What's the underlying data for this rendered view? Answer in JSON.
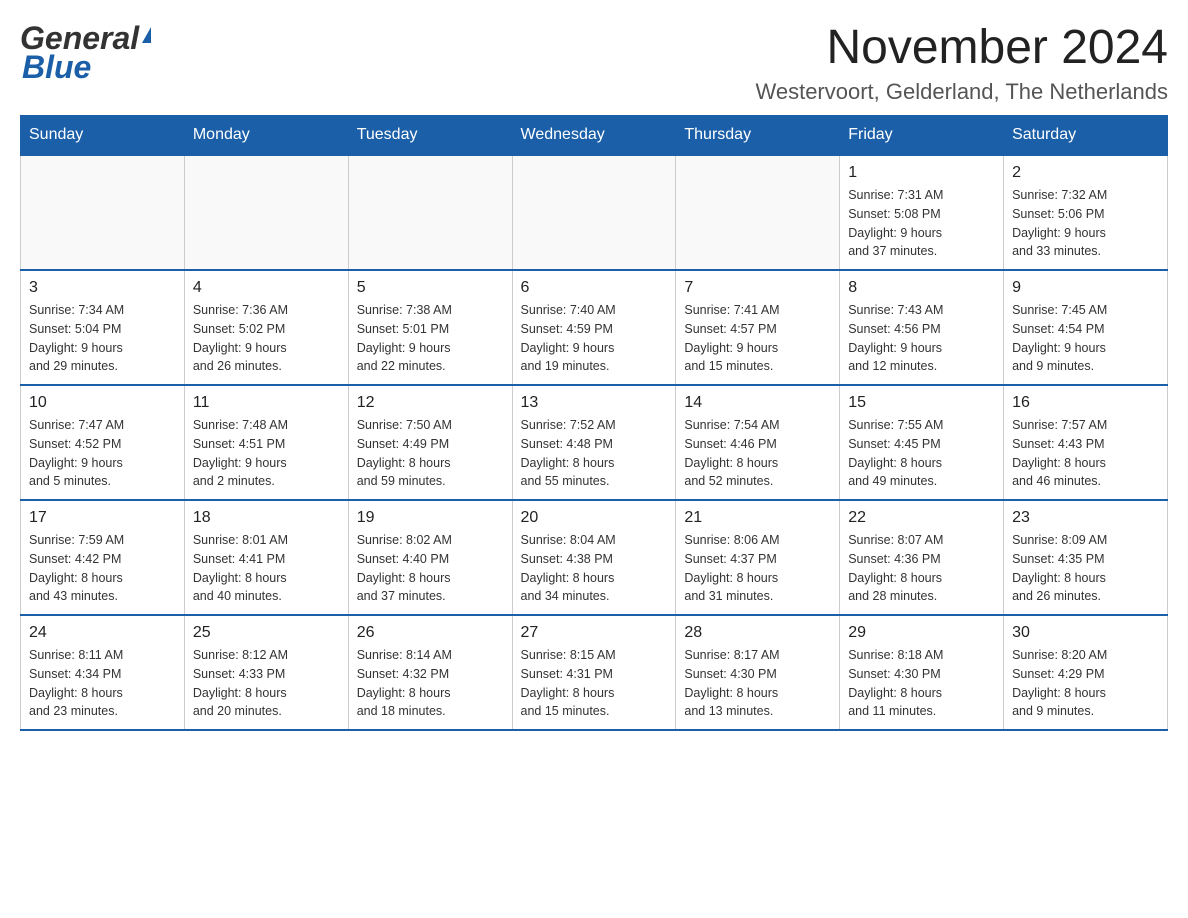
{
  "header": {
    "logo_general": "General",
    "logo_blue": "Blue",
    "month_title": "November 2024",
    "location": "Westervoort, Gelderland, The Netherlands"
  },
  "weekdays": [
    "Sunday",
    "Monday",
    "Tuesday",
    "Wednesday",
    "Thursday",
    "Friday",
    "Saturday"
  ],
  "weeks": [
    [
      {
        "day": "",
        "info": ""
      },
      {
        "day": "",
        "info": ""
      },
      {
        "day": "",
        "info": ""
      },
      {
        "day": "",
        "info": ""
      },
      {
        "day": "",
        "info": ""
      },
      {
        "day": "1",
        "info": "Sunrise: 7:31 AM\nSunset: 5:08 PM\nDaylight: 9 hours\nand 37 minutes."
      },
      {
        "day": "2",
        "info": "Sunrise: 7:32 AM\nSunset: 5:06 PM\nDaylight: 9 hours\nand 33 minutes."
      }
    ],
    [
      {
        "day": "3",
        "info": "Sunrise: 7:34 AM\nSunset: 5:04 PM\nDaylight: 9 hours\nand 29 minutes."
      },
      {
        "day": "4",
        "info": "Sunrise: 7:36 AM\nSunset: 5:02 PM\nDaylight: 9 hours\nand 26 minutes."
      },
      {
        "day": "5",
        "info": "Sunrise: 7:38 AM\nSunset: 5:01 PM\nDaylight: 9 hours\nand 22 minutes."
      },
      {
        "day": "6",
        "info": "Sunrise: 7:40 AM\nSunset: 4:59 PM\nDaylight: 9 hours\nand 19 minutes."
      },
      {
        "day": "7",
        "info": "Sunrise: 7:41 AM\nSunset: 4:57 PM\nDaylight: 9 hours\nand 15 minutes."
      },
      {
        "day": "8",
        "info": "Sunrise: 7:43 AM\nSunset: 4:56 PM\nDaylight: 9 hours\nand 12 minutes."
      },
      {
        "day": "9",
        "info": "Sunrise: 7:45 AM\nSunset: 4:54 PM\nDaylight: 9 hours\nand 9 minutes."
      }
    ],
    [
      {
        "day": "10",
        "info": "Sunrise: 7:47 AM\nSunset: 4:52 PM\nDaylight: 9 hours\nand 5 minutes."
      },
      {
        "day": "11",
        "info": "Sunrise: 7:48 AM\nSunset: 4:51 PM\nDaylight: 9 hours\nand 2 minutes."
      },
      {
        "day": "12",
        "info": "Sunrise: 7:50 AM\nSunset: 4:49 PM\nDaylight: 8 hours\nand 59 minutes."
      },
      {
        "day": "13",
        "info": "Sunrise: 7:52 AM\nSunset: 4:48 PM\nDaylight: 8 hours\nand 55 minutes."
      },
      {
        "day": "14",
        "info": "Sunrise: 7:54 AM\nSunset: 4:46 PM\nDaylight: 8 hours\nand 52 minutes."
      },
      {
        "day": "15",
        "info": "Sunrise: 7:55 AM\nSunset: 4:45 PM\nDaylight: 8 hours\nand 49 minutes."
      },
      {
        "day": "16",
        "info": "Sunrise: 7:57 AM\nSunset: 4:43 PM\nDaylight: 8 hours\nand 46 minutes."
      }
    ],
    [
      {
        "day": "17",
        "info": "Sunrise: 7:59 AM\nSunset: 4:42 PM\nDaylight: 8 hours\nand 43 minutes."
      },
      {
        "day": "18",
        "info": "Sunrise: 8:01 AM\nSunset: 4:41 PM\nDaylight: 8 hours\nand 40 minutes."
      },
      {
        "day": "19",
        "info": "Sunrise: 8:02 AM\nSunset: 4:40 PM\nDaylight: 8 hours\nand 37 minutes."
      },
      {
        "day": "20",
        "info": "Sunrise: 8:04 AM\nSunset: 4:38 PM\nDaylight: 8 hours\nand 34 minutes."
      },
      {
        "day": "21",
        "info": "Sunrise: 8:06 AM\nSunset: 4:37 PM\nDaylight: 8 hours\nand 31 minutes."
      },
      {
        "day": "22",
        "info": "Sunrise: 8:07 AM\nSunset: 4:36 PM\nDaylight: 8 hours\nand 28 minutes."
      },
      {
        "day": "23",
        "info": "Sunrise: 8:09 AM\nSunset: 4:35 PM\nDaylight: 8 hours\nand 26 minutes."
      }
    ],
    [
      {
        "day": "24",
        "info": "Sunrise: 8:11 AM\nSunset: 4:34 PM\nDaylight: 8 hours\nand 23 minutes."
      },
      {
        "day": "25",
        "info": "Sunrise: 8:12 AM\nSunset: 4:33 PM\nDaylight: 8 hours\nand 20 minutes."
      },
      {
        "day": "26",
        "info": "Sunrise: 8:14 AM\nSunset: 4:32 PM\nDaylight: 8 hours\nand 18 minutes."
      },
      {
        "day": "27",
        "info": "Sunrise: 8:15 AM\nSunset: 4:31 PM\nDaylight: 8 hours\nand 15 minutes."
      },
      {
        "day": "28",
        "info": "Sunrise: 8:17 AM\nSunset: 4:30 PM\nDaylight: 8 hours\nand 13 minutes."
      },
      {
        "day": "29",
        "info": "Sunrise: 8:18 AM\nSunset: 4:30 PM\nDaylight: 8 hours\nand 11 minutes."
      },
      {
        "day": "30",
        "info": "Sunrise: 8:20 AM\nSunset: 4:29 PM\nDaylight: 8 hours\nand 9 minutes."
      }
    ]
  ]
}
